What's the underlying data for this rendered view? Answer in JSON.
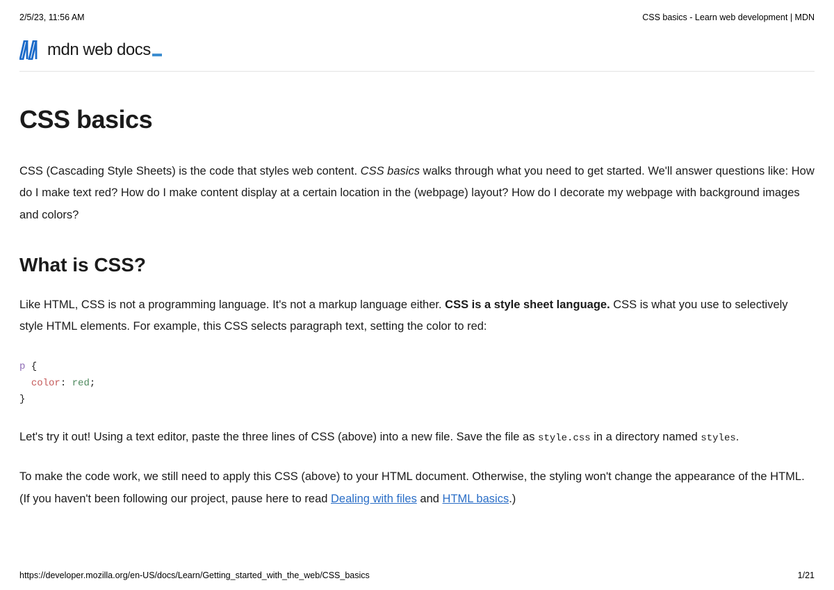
{
  "print_header": {
    "datetime": "2/5/23, 11:56 AM",
    "page_title_header": "CSS basics - Learn web development | MDN"
  },
  "logo": {
    "brand_text": "mdn web docs"
  },
  "page_title": "CSS basics",
  "intro": {
    "part1": "CSS (Cascading Style Sheets) is the code that styles web content. ",
    "italic": "CSS basics",
    "part2": " walks through what you need to get started. We'll answer questions like: How do I make text red? How do I make content display at a certain location in the (webpage) layout? How do I decorate my webpage with background images and colors?"
  },
  "section1": {
    "heading": "What is CSS?",
    "para1_part1": "Like HTML, CSS is not a programming language. It's not a markup language either. ",
    "para1_bold": "CSS is a style sheet language.",
    "para1_part2": " CSS is what you use to selectively style HTML elements. For example, this CSS selects paragraph text, setting the color to red:",
    "code": {
      "line1_sel": "p",
      "line1_brace": " {",
      "line2_prop": "color",
      "line2_colon": ": ",
      "line2_val": "red",
      "line2_semi": ";",
      "line3": "}"
    },
    "para2_part1": "Let's try it out! Using a text editor, paste the three lines of CSS (above) into a new file. Save the file as ",
    "para2_code1": "style.css",
    "para2_part2": " in a directory named ",
    "para2_code2": "styles",
    "para2_part3": ".",
    "para3_part1": "To make the code work, we still need to apply this CSS (above) to your HTML document. Otherwise, the styling won't change the appearance of the HTML. (If you haven't been following our project, pause here to read ",
    "para3_link1": "Dealing with files",
    "para3_mid": " and ",
    "para3_link2": "HTML basics",
    "para3_end": ".)"
  },
  "print_footer": {
    "url": "https://developer.mozilla.org/en-US/docs/Learn/Getting_started_with_the_web/CSS_basics",
    "page_num": "1/21"
  }
}
